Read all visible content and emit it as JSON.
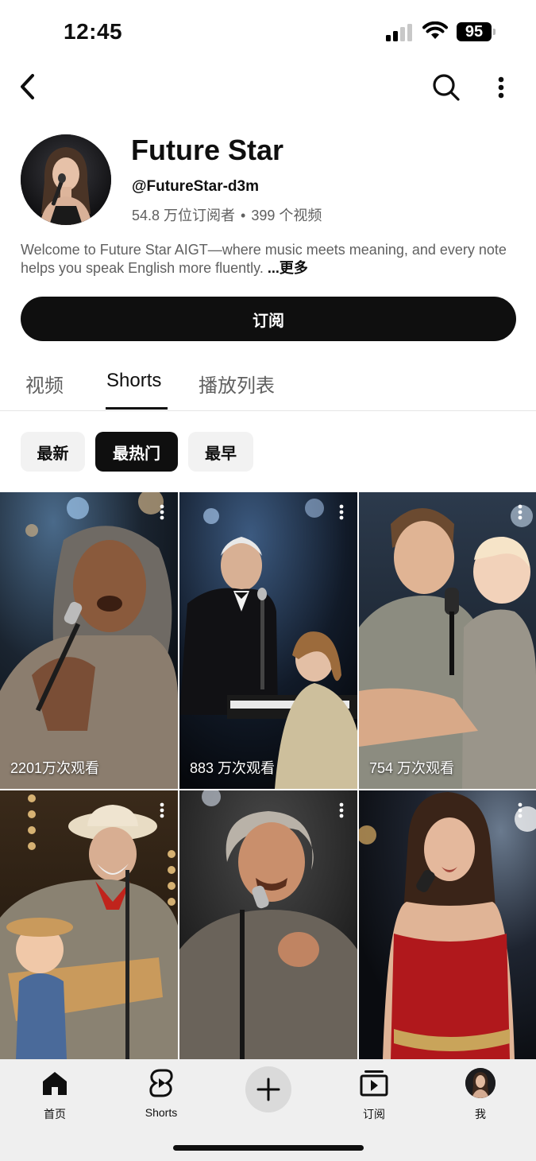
{
  "status_bar": {
    "time": "12:45",
    "battery": "95",
    "icons": [
      "cellular-signal-icon",
      "wifi-icon",
      "battery-icon"
    ]
  },
  "top_nav": {
    "icons": [
      "back-arrow-icon",
      "search-icon",
      "more-vertical-icon"
    ]
  },
  "channel": {
    "name": "Future Star",
    "handle": "@FutureStar-d3m",
    "subscribers": "54.8 万位订阅者",
    "separator": "•",
    "videos": "399 个视频",
    "description": "Welcome to Future Star AIGT—where music meets meaning, and every note helps you speak English more fluently. ",
    "more_label": "...更多",
    "subscribe_label": "订阅"
  },
  "tabs": [
    {
      "label": "视频",
      "active": false
    },
    {
      "label": "Shorts",
      "active": true
    },
    {
      "label": "播放列表",
      "active": false
    }
  ],
  "filter_chips": [
    {
      "label": "最新",
      "selected": false
    },
    {
      "label": "最热门",
      "selected": true
    },
    {
      "label": "最早",
      "selected": false
    }
  ],
  "shorts": [
    {
      "views": "2201万次观看"
    },
    {
      "views": "883 万次观看"
    },
    {
      "views": "754 万次观看"
    },
    {
      "views": ""
    },
    {
      "views": ""
    },
    {
      "views": ""
    }
  ],
  "bottom_nav": {
    "items": [
      {
        "label": "首页",
        "icon": "home-icon"
      },
      {
        "label": "Shorts",
        "icon": "shorts-icon"
      },
      {
        "label": "",
        "icon": "plus-icon"
      },
      {
        "label": "订阅",
        "icon": "subscriptions-icon"
      },
      {
        "label": "我",
        "icon": "profile-avatar"
      }
    ]
  },
  "colors": {
    "primary_text": "#0f0f0f",
    "secondary_text": "#606060",
    "chip_background": "#f2f2f2",
    "subscribe_background": "#0f0f0f"
  }
}
